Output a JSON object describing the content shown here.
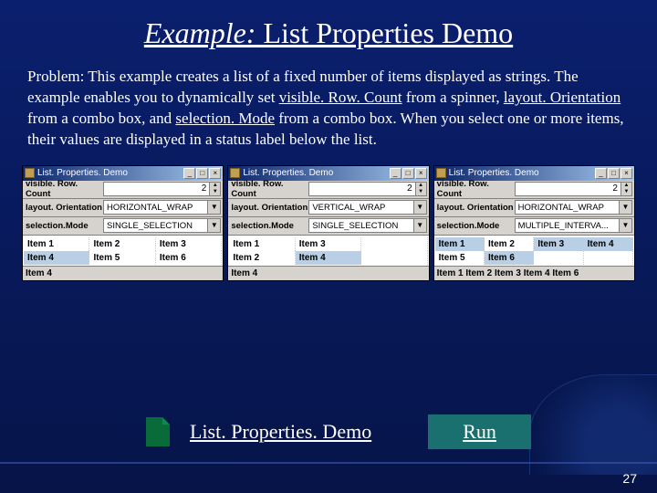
{
  "title": {
    "prefix": "Example:",
    "rest": " List Properties Demo"
  },
  "problem": {
    "lead": "Problem: This example creates a list of a fixed number of items displayed as strings. The example enables you to dynamically set ",
    "u1": "visible. Row. Count",
    "mid1": " from a spinner, ",
    "u2": "layout. Orientation",
    "mid2": " from a combo box, and ",
    "u3": "selection. Mode",
    "tail": " from a combo box. When you select one or more items, their values are displayed in a status label below the list."
  },
  "panels": [
    {
      "title": "List. Properties. Demo",
      "rows": {
        "vrc_label": "visible. Row. Count",
        "vrc_value": "2",
        "lo_label": "layout. Orientation",
        "lo_value": "HORIZONTAL_WRAP",
        "sm_label": "selection.Mode",
        "sm_value": "SINGLE_SELECTION"
      },
      "grid": "grid3",
      "items": [
        "Item 1",
        "Item 2",
        "Item 3",
        "Item 4",
        "Item 5",
        "Item 6"
      ],
      "selected": [
        3
      ],
      "status": "Item 4"
    },
    {
      "title": "List. Properties. Demo",
      "rows": {
        "vrc_label": "visible. Row. Count",
        "vrc_value": "2",
        "lo_label": "layout. Orientation",
        "lo_value": "VERTICAL_WRAP",
        "sm_label": "selection.Mode",
        "sm_value": "SINGLE_SELECTION"
      },
      "grid": "grid3",
      "items": [
        "Item 1",
        "Item 3",
        "",
        "Item 2",
        "Item 4",
        ""
      ],
      "selected": [
        4
      ],
      "status": "Item 4"
    },
    {
      "title": "List. Properties. Demo",
      "rows": {
        "vrc_label": "visible. Row. Count",
        "vrc_value": "2",
        "lo_label": "layout. Orientation",
        "lo_value": "HORIZONTAL_WRAP",
        "sm_label": "selection.Mode",
        "sm_value": "MULTIPLE_INTERVA..."
      },
      "grid": "grid4",
      "items": [
        "Item 1",
        "Item 2",
        "Item 3",
        "Item 4",
        "Item 5",
        "Item 6",
        "",
        ""
      ],
      "selected": [
        0,
        2,
        3,
        5
      ],
      "status": "Item 1 Item 2 Item 3 Item 4 Item 6"
    }
  ],
  "bottom": {
    "link_text": "List. Properties. Demo",
    "run_label": "Run"
  },
  "page_number": "27",
  "window_buttons": {
    "min": "_",
    "max": "□",
    "close": "×"
  },
  "spinner_arrows": {
    "up": "▲",
    "down": "▼"
  },
  "combo_arrow": "▼"
}
